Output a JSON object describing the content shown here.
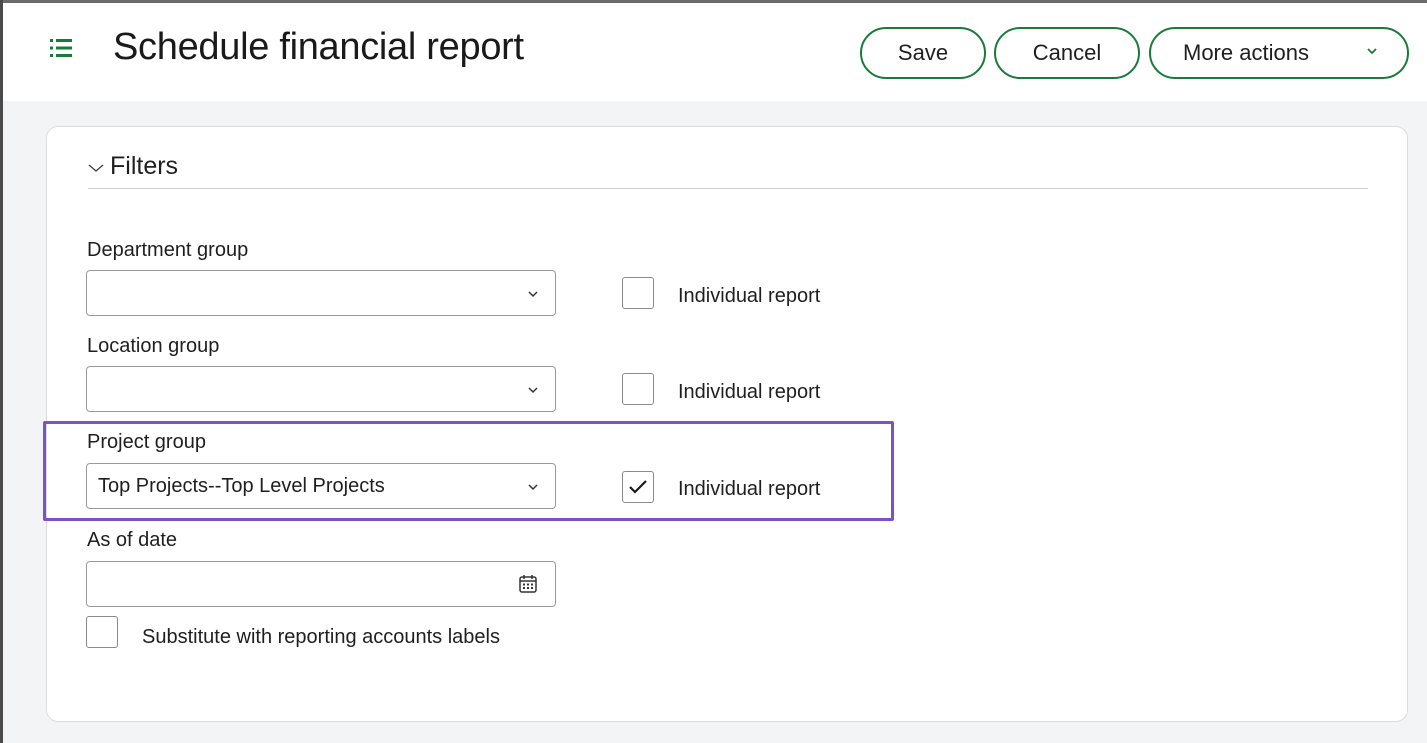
{
  "header": {
    "title": "Schedule financial report",
    "menu_icon": "list-menu-icon",
    "buttons": {
      "save": "Save",
      "cancel": "Cancel",
      "more_actions": "More actions"
    },
    "accent_color": "#1a7a3a"
  },
  "filters": {
    "section_label": "Filters",
    "expanded": true,
    "department_group": {
      "label": "Department group",
      "value": "",
      "individual_report_label": "Individual report",
      "individual_report_checked": false
    },
    "location_group": {
      "label": "Location group",
      "value": "",
      "individual_report_label": "Individual report",
      "individual_report_checked": false
    },
    "project_group": {
      "label": "Project group",
      "value": "Top Projects--Top Level Projects",
      "individual_report_label": "Individual report",
      "individual_report_checked": true,
      "highlight_color": "#7b52c7"
    },
    "as_of_date": {
      "label": "As of date",
      "value": "",
      "icon": "calendar-icon"
    },
    "substitute": {
      "label": "Substitute with reporting accounts labels",
      "checked": false
    }
  }
}
